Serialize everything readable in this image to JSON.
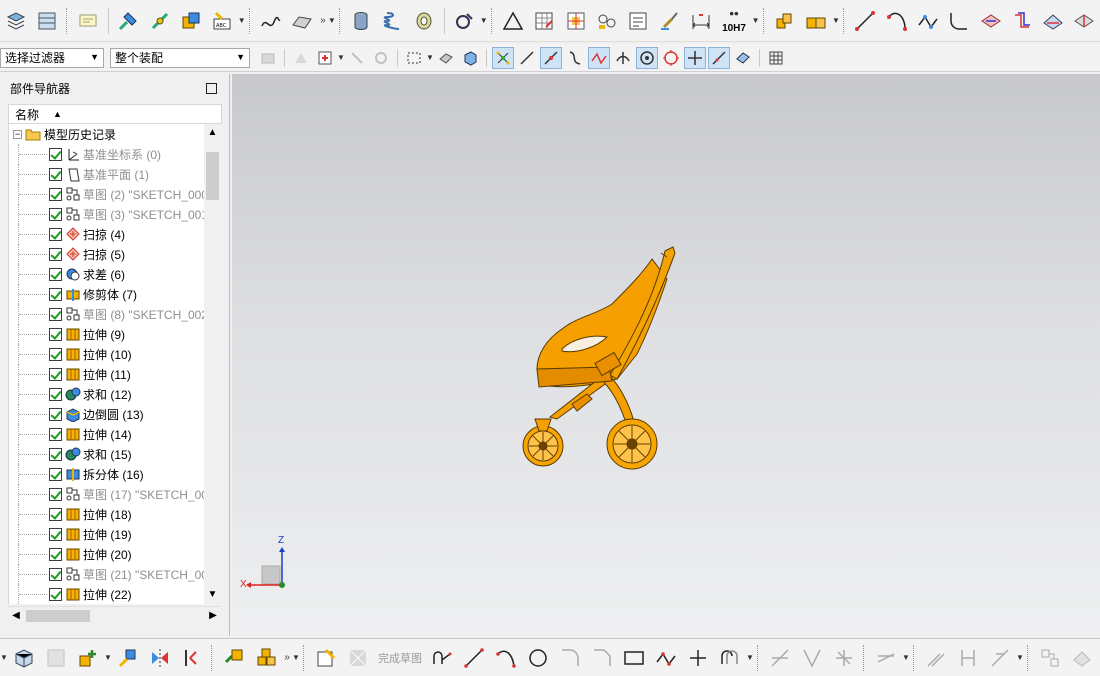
{
  "app": "NX",
  "selection_filter": {
    "value": "选择过滤器"
  },
  "assembly_scope": {
    "value": "整个装配"
  },
  "nav": {
    "title": "部件导航器",
    "column_name": "名称",
    "root_label": "模型历史记录",
    "items": [
      {
        "label": "基准坐标系 (0)",
        "icon": "datum-csys-icon",
        "dim": true
      },
      {
        "label": "基准平面 (1)",
        "icon": "datum-plane-icon",
        "dim": true
      },
      {
        "label": "草图 (2) \"SKETCH_000",
        "icon": "sketch-icon",
        "dim": true
      },
      {
        "label": "草图 (3) \"SKETCH_001",
        "icon": "sketch-icon",
        "dim": true
      },
      {
        "label": "扫掠 (4)",
        "icon": "swept-icon",
        "dim": false
      },
      {
        "label": "扫掠 (5)",
        "icon": "swept-icon",
        "dim": false
      },
      {
        "label": "求差 (6)",
        "icon": "subtract-icon",
        "dim": false
      },
      {
        "label": "修剪体 (7)",
        "icon": "trim-body-icon",
        "dim": false
      },
      {
        "label": "草图 (8) \"SKETCH_002",
        "icon": "sketch-icon",
        "dim": true
      },
      {
        "label": "拉伸 (9)",
        "icon": "extrude-icon",
        "dim": false
      },
      {
        "label": "拉伸 (10)",
        "icon": "extrude-icon",
        "dim": false
      },
      {
        "label": "拉伸 (11)",
        "icon": "extrude-icon",
        "dim": false
      },
      {
        "label": "求和 (12)",
        "icon": "unite-icon",
        "dim": false
      },
      {
        "label": "边倒圆 (13)",
        "icon": "edge-blend-icon",
        "dim": false
      },
      {
        "label": "拉伸 (14)",
        "icon": "extrude-icon",
        "dim": false
      },
      {
        "label": "求和 (15)",
        "icon": "unite-icon",
        "dim": false
      },
      {
        "label": "拆分体 (16)",
        "icon": "split-body-icon",
        "dim": false
      },
      {
        "label": "草图 (17) \"SKETCH_00",
        "icon": "sketch-icon",
        "dim": true
      },
      {
        "label": "拉伸 (18)",
        "icon": "extrude-icon",
        "dim": false
      },
      {
        "label": "拉伸 (19)",
        "icon": "extrude-icon",
        "dim": false
      },
      {
        "label": "拉伸 (20)",
        "icon": "extrude-icon",
        "dim": false
      },
      {
        "label": "草图 (21) \"SKETCH_00",
        "icon": "sketch-icon",
        "dim": true
      },
      {
        "label": "拉伸 (22)",
        "icon": "extrude-icon",
        "dim": false
      }
    ]
  },
  "bottom_toolbar": {
    "finish_sketch_label": "完成草图"
  },
  "top_toolbar": {
    "tolerance_label": "10H7"
  },
  "triad": {
    "z": "Z",
    "x": "X"
  },
  "colors": {
    "model_orange": "#f5a000",
    "check_green": "#1c9a1c"
  }
}
